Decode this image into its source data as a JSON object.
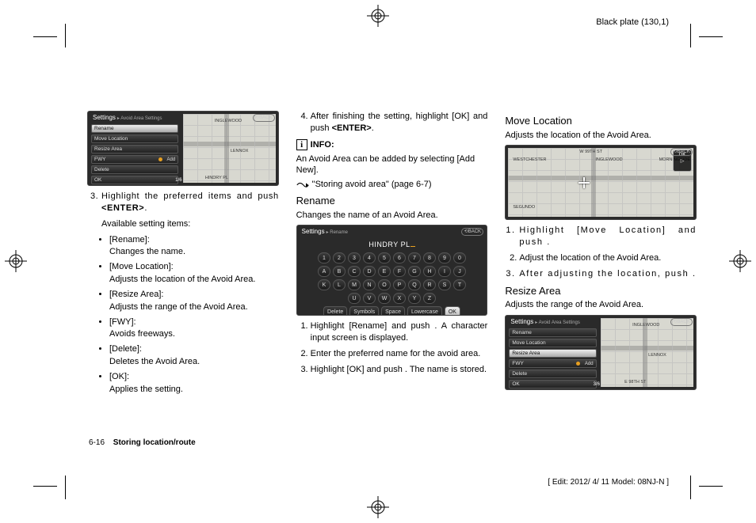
{
  "meta": {
    "black_plate": "Black plate (130,1)",
    "edit_line": "[ Edit: 2012/ 4/ 11   Model: 08NJ-N ]",
    "page_num": "6-16",
    "footer_title": "Storing location/route"
  },
  "screenshot_common": {
    "title": "Settings",
    "breadcrumb": "Avoid Area Settings",
    "back": "BACK",
    "ok_box": {
      "ok": "OK",
      "sub": "▷"
    }
  },
  "screenshot1": {
    "menu": [
      "Rename",
      "Move Location",
      "Resize Area",
      "FWY",
      "Delete",
      "OK"
    ],
    "selected": "Rename",
    "fwy_add": "Add",
    "fraction": "1/6",
    "map_labels": [
      "INGLEWOOD",
      "LENNOX",
      "HINDRY PL"
    ]
  },
  "col1": {
    "step3": "Highlight the preferred items and push ",
    "enter": "<ENTER>",
    "available": "Available setting items:",
    "items": [
      {
        "name": "[Rename]:",
        "desc": "Changes the name."
      },
      {
        "name": "[Move Location]:",
        "desc": "Adjusts the location of the Avoid Area."
      },
      {
        "name": "[Resize Area]:",
        "desc": "Adjusts the range of the Avoid Area."
      },
      {
        "name": "[FWY]:",
        "desc": "Avoids freeways."
      },
      {
        "name": "[Delete]:",
        "desc": "Deletes the Avoid Area."
      },
      {
        "name": "[OK]:",
        "desc": "Applies the setting."
      }
    ]
  },
  "col2": {
    "step4": "After finishing the setting, highlight [OK] and push ",
    "info_label": "INFO:",
    "info_body": "An Avoid Area can be added by selecting [Add New].",
    "ref": "\"Storing avoid area\" (page 6-7)",
    "rename_head": "Rename",
    "rename_sub": "Changes the name of an Avoid Area.",
    "kb": {
      "title": "Settings",
      "breadcrumb": "Rename",
      "name": "HINDRY PL",
      "rows": [
        [
          "1",
          "2",
          "3",
          "4",
          "5",
          "6",
          "7",
          "8",
          "9",
          "0"
        ],
        [
          "A",
          "B",
          "C",
          "D",
          "E",
          "F",
          "G",
          "H",
          "I",
          "J"
        ],
        [
          "K",
          "L",
          "M",
          "N",
          "O",
          "P",
          "Q",
          "R",
          "S",
          "T"
        ],
        [
          "U",
          "V",
          "W",
          "X",
          "Y",
          "Z"
        ]
      ],
      "bottom": [
        "Delete",
        "Symbols",
        "Space",
        "Lowercase",
        "OK"
      ]
    },
    "steps": [
      {
        "a": "Highlight [Rename] and push ",
        "b": ". A character input screen is displayed."
      },
      {
        "a": "Enter the preferred name for the avoid area.",
        "b": ""
      },
      {
        "a": "Highlight [OK] and push ",
        "b": ". The name is stored."
      }
    ]
  },
  "col3": {
    "move_head": "Move Location",
    "move_sub": "Adjusts the location of the Avoid Area.",
    "move_map_labels": [
      "WESTCHESTER",
      "INGLEWOOD",
      "MORNINGSIDE",
      "SEGUNDO",
      "W 99TH ST"
    ],
    "move_steps": [
      {
        "a": "Highlight [Move Location] and push ",
        "b": "."
      },
      {
        "a": "Adjust the location of the Avoid Area.",
        "b": ""
      },
      {
        "a": "After adjusting the location, push ",
        "b": "."
      }
    ],
    "resize_head": "Resize Area",
    "resize_sub": "Adjusts the range of the Avoid Area.",
    "resize_ss": {
      "menu": [
        "Rename",
        "Move Location",
        "Resize Area",
        "FWY",
        "Delete",
        "OK"
      ],
      "selected": "Resize Area",
      "fraction": "3/6",
      "map_labels": [
        "INGLEWOOD",
        "LENNOX",
        "E 98TH ST"
      ]
    }
  }
}
